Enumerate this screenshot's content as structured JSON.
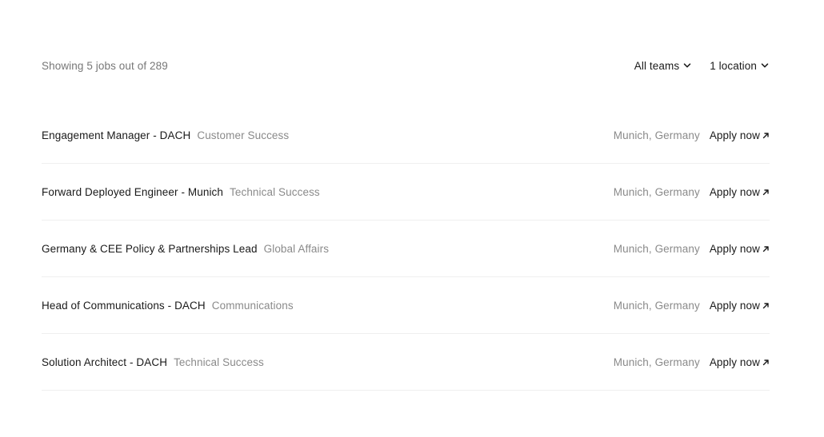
{
  "summary": {
    "text": "Showing 5 jobs out of 289"
  },
  "filters": {
    "teams_label": "All teams",
    "location_label": "1 location"
  },
  "jobs": [
    {
      "title": "Engagement Manager - DACH",
      "team": "Customer Success",
      "location": "Munich, Germany",
      "apply_label": "Apply now"
    },
    {
      "title": "Forward Deployed Engineer - Munich",
      "team": "Technical Success",
      "location": "Munich, Germany",
      "apply_label": "Apply now"
    },
    {
      "title": "Germany & CEE Policy & Partnerships Lead",
      "team": "Global Affairs",
      "location": "Munich, Germany",
      "apply_label": "Apply now"
    },
    {
      "title": "Head of Communications - DACH",
      "team": "Communications",
      "location": "Munich, Germany",
      "apply_label": "Apply now"
    },
    {
      "title": "Solution Architect - DACH",
      "team": "Technical Success",
      "location": "Munich, Germany",
      "apply_label": "Apply now"
    }
  ],
  "icons": {
    "dropdown": "chevron-down-icon",
    "external": "arrow-up-right-icon"
  },
  "colors": {
    "text": "#1a1a1a",
    "muted": "#8a8a8a",
    "divider": "#efefef"
  }
}
